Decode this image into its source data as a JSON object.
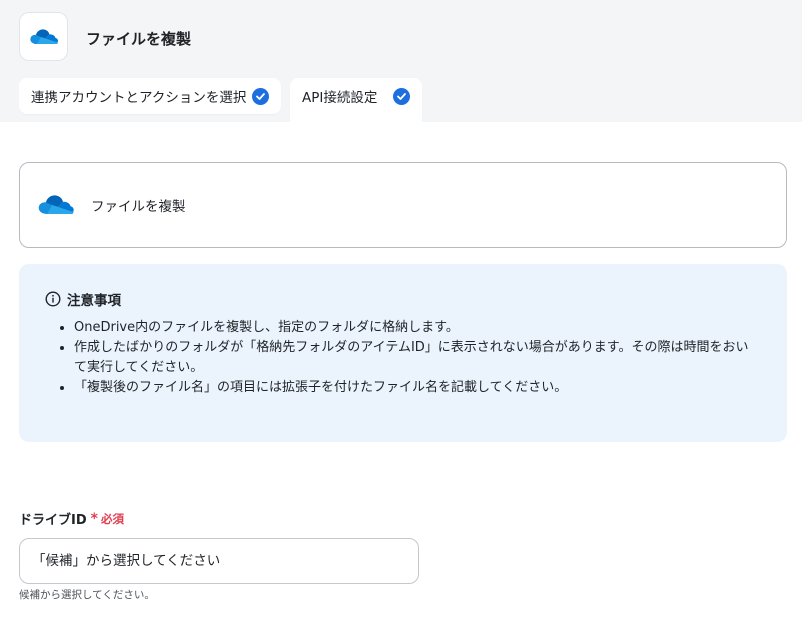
{
  "header": {
    "app_title": "ファイルを複製",
    "app_icon": "onedrive-cloud-icon",
    "tabs": [
      {
        "label": "連携アカウントとアクションを選択",
        "completed": true
      },
      {
        "label": "API接続設定",
        "completed": true,
        "active": true
      }
    ]
  },
  "action_card": {
    "label": "ファイルを複製",
    "icon": "onedrive-cloud-icon"
  },
  "notice": {
    "title": "注意事項",
    "items": [
      "OneDrive内のファイルを複製し、指定のフォルダに格納します。",
      "作成したばかりのフォルダが「格納先フォルダのアイテムID」に表示されない場合があります。その際は時間をおいて実行してください。",
      "「複製後のファイル名」の項目には拡張子を付けたファイル名を記載してください。"
    ]
  },
  "drive_field": {
    "label": "ドライブID",
    "required_mark": "*",
    "required_text": "必須",
    "placeholder": "「候補」から選択してください",
    "help": "候補から選択してください。"
  },
  "colors": {
    "accent": "#1d6fe0",
    "required": "#e03e52",
    "notice_bg": "#ebf4fc",
    "header_bg": "#f4f5f6"
  }
}
